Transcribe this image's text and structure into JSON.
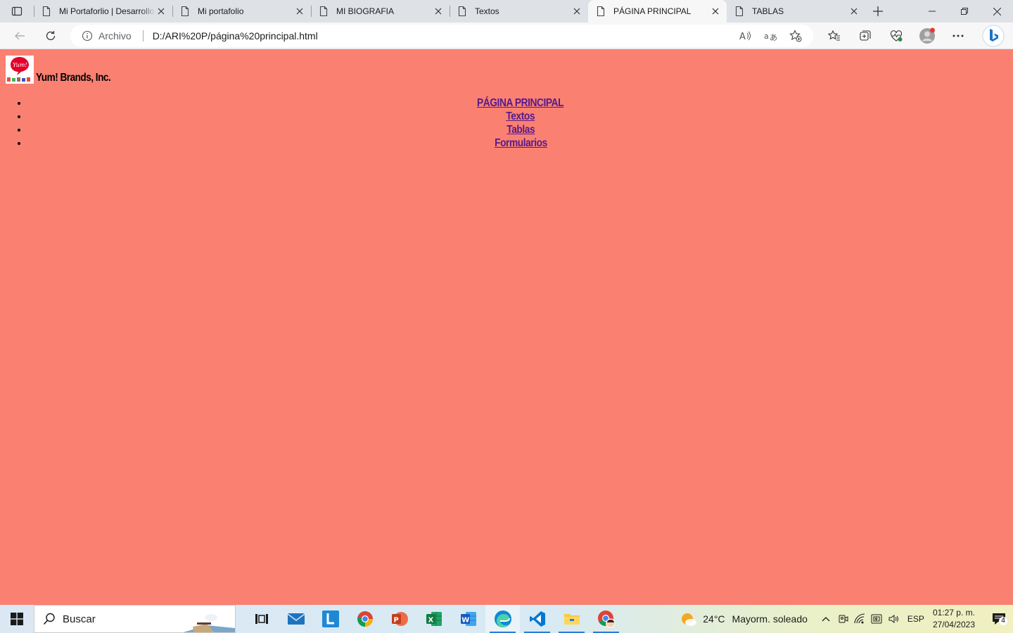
{
  "browser": {
    "tabs": [
      {
        "title": "Mi Portaforlio | Desarrollo",
        "active": false
      },
      {
        "title": "Mi portafolio",
        "active": false
      },
      {
        "title": "MI BIOGRAFIA",
        "active": false
      },
      {
        "title": "Textos",
        "active": false
      },
      {
        "title": "PÁGINA PRINCIPAL",
        "active": true
      },
      {
        "title": "TABLAS",
        "active": false
      }
    ],
    "address": {
      "site_label": "Archivo",
      "url": "D:/ARI%20P/página%20principal.html"
    }
  },
  "page": {
    "background": "#fa8072",
    "logo_text": "Yum!",
    "brand_name": "Yum! Brands, Inc.",
    "menu": [
      {
        "label": "PÁGINA PRINCIPAL"
      },
      {
        "label": "Textos"
      },
      {
        "label": "Tablas"
      },
      {
        "label": "Formularios"
      }
    ],
    "link_color": "#551a8b"
  },
  "taskbar": {
    "search_placeholder": "Buscar",
    "apps": [
      "task-view",
      "mail",
      "l-app",
      "chrome",
      "powerpoint",
      "excel",
      "word",
      "edge",
      "vscode",
      "file-explorer",
      "chrome-profile"
    ],
    "weather": {
      "temp": "24°C",
      "condition": "Mayorm. soleado"
    },
    "language": "ESP",
    "time": "01:27 p. m.",
    "date": "27/04/2023",
    "notification_count": "4"
  }
}
